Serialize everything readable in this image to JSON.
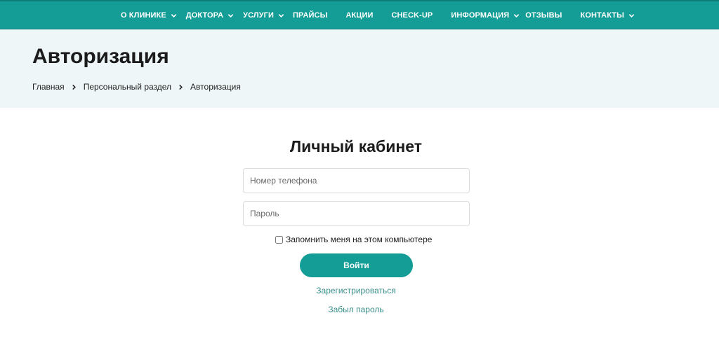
{
  "nav": {
    "items": [
      {
        "label": "О клинике",
        "has_dropdown": true
      },
      {
        "label": "Доктора",
        "has_dropdown": true
      },
      {
        "label": "Услуги",
        "has_dropdown": true
      },
      {
        "label": "Прайсы",
        "has_dropdown": false
      },
      {
        "label": "Акции",
        "has_dropdown": false
      },
      {
        "label": "Check-Up",
        "has_dropdown": false
      },
      {
        "label": "Информация",
        "has_dropdown": true
      },
      {
        "label": "Отзывы",
        "has_dropdown": false
      },
      {
        "label": "Контакты",
        "has_dropdown": true
      }
    ],
    "dropdown_icon": "chevron-down-icon",
    "background": "#149c96"
  },
  "header": {
    "title": "Авторизация",
    "breadcrumb": [
      "Главная",
      "Персональный раздел",
      "Авторизация"
    ],
    "separator_icon": "chevron-right-icon",
    "background": "#eef6f8"
  },
  "login": {
    "title": "Личный кабинет",
    "phone_placeholder": "Номер телефона",
    "phone_value": "",
    "password_placeholder": "Пароль",
    "password_value": "",
    "remember_label": "Запомнить меня на этом компьютере",
    "remember_checked": false,
    "submit_label": "Войти",
    "register_link": "Зарегистрироваться",
    "forgot_link": "Забыл пароль",
    "accent_color": "#149c96",
    "link_color": "#3a8f8a"
  }
}
